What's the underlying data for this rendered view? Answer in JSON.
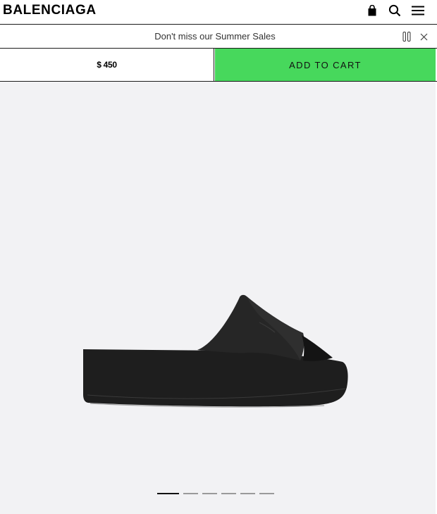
{
  "header": {
    "logo": "BALENCIAGA",
    "icons": [
      "shopping-bag-icon",
      "search-icon",
      "menu-icon"
    ]
  },
  "banner": {
    "text": "Don't miss our Summer Sales",
    "icons": [
      "pause-icon",
      "close-icon"
    ]
  },
  "buy_bar": {
    "price": "$ 450",
    "add_to_cart_label": "ADD TO CART",
    "accent_color": "#47d85c"
  },
  "gallery": {
    "slide_count": 6,
    "active_slide": 1
  }
}
